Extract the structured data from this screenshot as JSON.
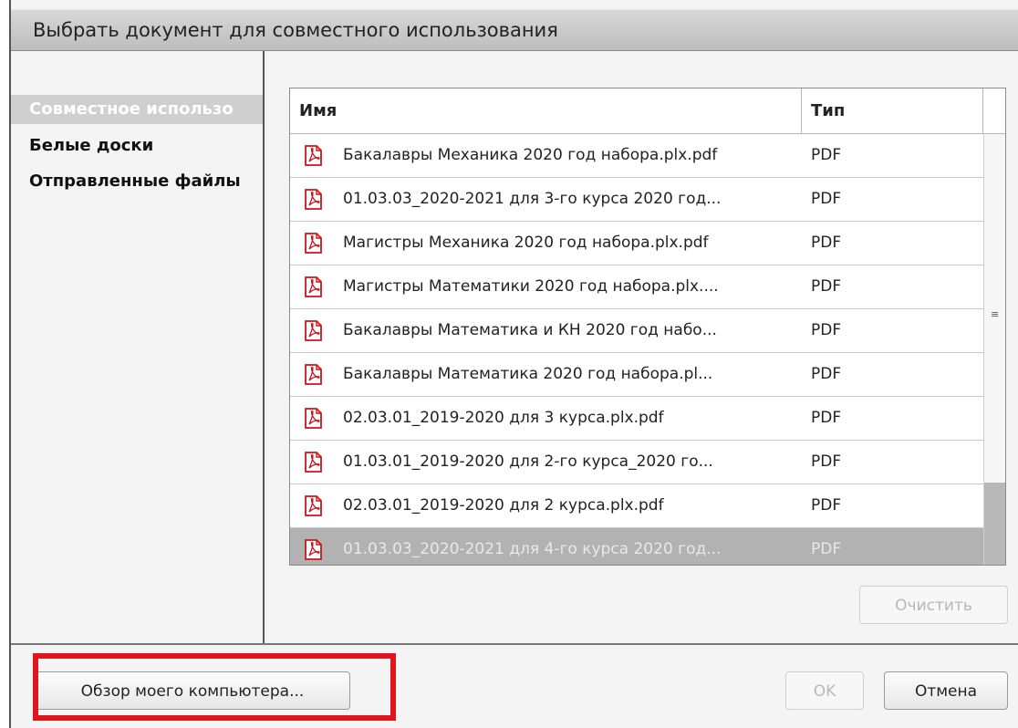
{
  "dialog": {
    "title": "Выбрать документ для совместного использования"
  },
  "sidebar": {
    "items": [
      {
        "label": "Совместное использо",
        "selected": true
      },
      {
        "label": "Белые доски",
        "selected": false
      },
      {
        "label": "Отправленные файлы",
        "selected": false
      }
    ]
  },
  "table": {
    "columns": [
      "Имя",
      "Тип"
    ],
    "rows": [
      {
        "name": "Бакалавры Механика 2020 год набора.plx.pdf",
        "type": "PDF"
      },
      {
        "name": "01.03.03_2020-2021 для 3-го курса 2020 год...",
        "type": "PDF"
      },
      {
        "name": "Магистры Механика 2020 год набора.plx.pdf",
        "type": "PDF"
      },
      {
        "name": "Магистры Математики 2020 год набора.plx....",
        "type": "PDF"
      },
      {
        "name": "Бакалавры Математика и КН 2020 год набо...",
        "type": "PDF"
      },
      {
        "name": "Бакалавры Математика 2020 год набора.pl...",
        "type": "PDF"
      },
      {
        "name": "02.03.01_2019-2020 для 3 курса.plx.pdf",
        "type": "PDF"
      },
      {
        "name": "01.03.01_2019-2020 для 2-го курса_2020 го...",
        "type": "PDF"
      },
      {
        "name": "02.03.01_2019-2020 для 2 курса.plx.pdf",
        "type": "PDF"
      },
      {
        "name": "01.03.03_2020-2021 для 4-го курса 2020 год...",
        "type": "PDF",
        "selected": true
      }
    ],
    "row_icon": "pdf-file-icon",
    "scroll_grip": "≡"
  },
  "buttons": {
    "clear": "Очистить",
    "browse": "Обзор моего компьютера...",
    "ok": "OK",
    "cancel": "Отмена"
  },
  "colors": {
    "highlight": "#e0151e",
    "pdf_icon": "#c8161d",
    "selection": "#b2b2b2"
  }
}
